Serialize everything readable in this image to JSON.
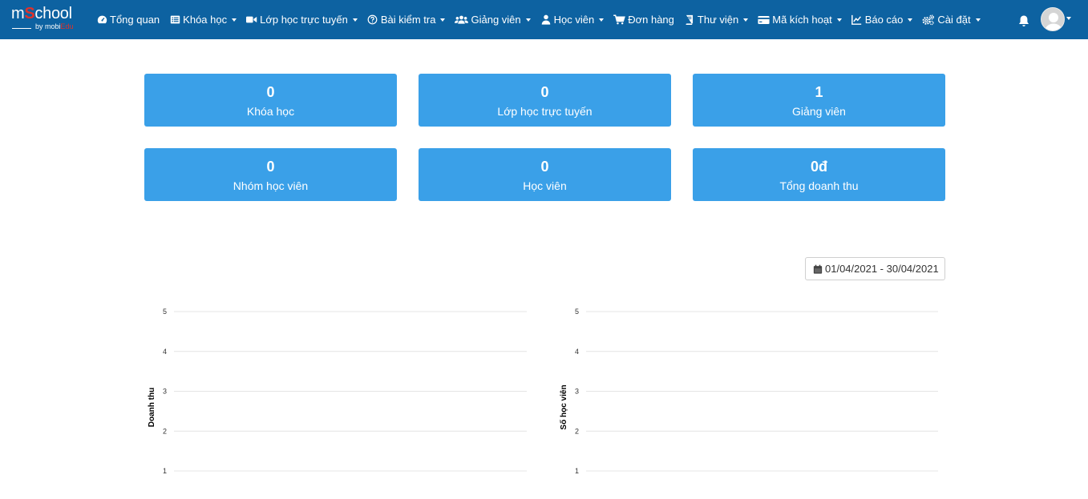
{
  "brand": {
    "logo_main_prefix": "m",
    "logo_main_o": "S",
    "logo_main_suffix": "chool",
    "logo_sub_prefix": "by mobi",
    "logo_sub_red": "Edu",
    "logo_color_red": "#e0322b"
  },
  "colors": {
    "navbar_bg": "#0d62a1",
    "card_bg": "#3aa0e8"
  },
  "nav": {
    "items": [
      {
        "label": "Tổng quan",
        "icon": "dashboard-icon",
        "dropdown": false
      },
      {
        "label": "Khóa học",
        "icon": "list-icon",
        "dropdown": true
      },
      {
        "label": "Lớp học trực tuyến",
        "icon": "video-icon",
        "dropdown": true
      },
      {
        "label": "Bài kiểm tra",
        "icon": "question-circle-icon",
        "dropdown": true
      },
      {
        "label": "Giảng viên",
        "icon": "users-icon",
        "dropdown": true
      },
      {
        "label": "Học viên",
        "icon": "user-icon",
        "dropdown": true
      },
      {
        "label": "Đơn hàng",
        "icon": "cart-icon",
        "dropdown": false
      },
      {
        "label": "Thư viện",
        "icon": "book-icon",
        "dropdown": true
      },
      {
        "label": "Mã kích hoạt",
        "icon": "credit-card-icon",
        "dropdown": true
      },
      {
        "label": "Báo cáo",
        "icon": "line-chart-icon",
        "dropdown": true
      },
      {
        "label": "Cài đặt",
        "icon": "cogs-icon",
        "dropdown": true
      }
    ],
    "notifications_icon": "bell-icon",
    "avatar_icon": "user-avatar-icon"
  },
  "stats": [
    {
      "value": "0",
      "label": "Khóa học"
    },
    {
      "value": "0",
      "label": "Lớp học trực tuyến"
    },
    {
      "value": "1",
      "label": "Giảng viên"
    },
    {
      "value": "0",
      "label": "Nhóm học viên"
    },
    {
      "value": "0",
      "label": "Học viên"
    },
    {
      "value": "0đ",
      "label": "Tổng doanh thu"
    }
  ],
  "date_range": {
    "label": "01/04/2021 - 30/04/2021",
    "icon": "calendar-icon"
  },
  "chart_data": [
    {
      "type": "line",
      "title": "",
      "xlabel": "",
      "ylabel": "Doanh thu",
      "yticks": [
        "1",
        "2",
        "3",
        "4",
        "5"
      ],
      "ylim": [
        1,
        5
      ],
      "grid": true,
      "series": []
    },
    {
      "type": "line",
      "title": "",
      "xlabel": "",
      "ylabel": "Số học viên",
      "yticks": [
        "1",
        "2",
        "3",
        "4",
        "5"
      ],
      "ylim": [
        1,
        5
      ],
      "grid": true,
      "series": []
    }
  ]
}
